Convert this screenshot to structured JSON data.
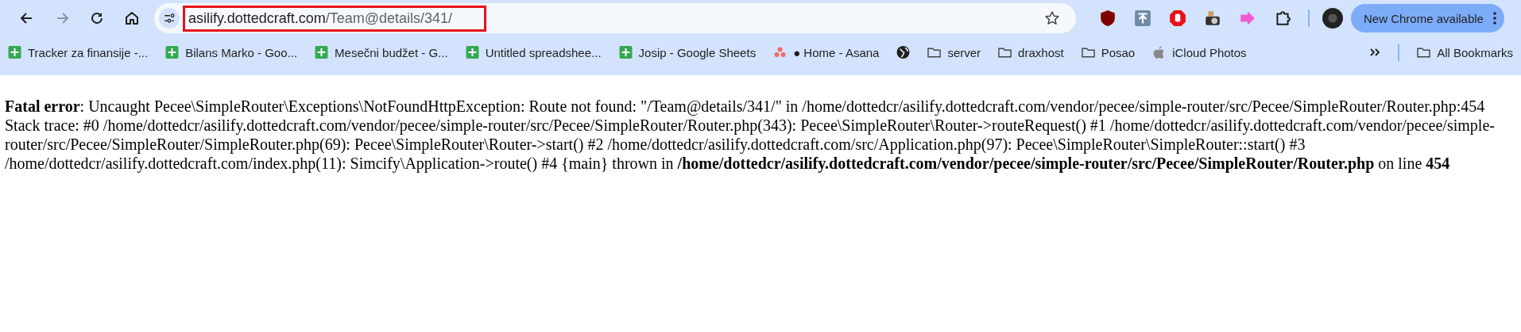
{
  "toolbar": {
    "url_host": "asilify.dottedcraft.com",
    "url_path": "/Team@details/341/",
    "url_highlighted": true,
    "update_button": "New Chrome available"
  },
  "bookmarks": [
    {
      "kind": "sheets",
      "label": "Tracker za finansije -..."
    },
    {
      "kind": "sheets",
      "label": "Bilans Marko - Goo..."
    },
    {
      "kind": "sheets",
      "label": "Mesečni budžet - G..."
    },
    {
      "kind": "sheets",
      "label": "Untitled spreadshee..."
    },
    {
      "kind": "sheets",
      "label": "Josip - Google Sheets"
    },
    {
      "kind": "asana",
      "label": "● Home - Asana"
    },
    {
      "kind": "globe"
    },
    {
      "kind": "folder",
      "label": "server"
    },
    {
      "kind": "folder",
      "label": "draxhost"
    },
    {
      "kind": "folder",
      "label": "Posao"
    },
    {
      "kind": "apple",
      "label": "iCloud Photos"
    }
  ],
  "all_bookmarks": "All Bookmarks",
  "error": {
    "message": "**Fatal error**: Uncaught Pecee\\SimpleRouter\\Exceptions\\NotFoundHttpException: Route not found: \"/Team@details/341/\" in /home/dottedcr/asilify.dottedcraft.com/vendor/pecee/simple-router/src/Pecee/SimpleRouter/Router.php:454 Stack trace: #0 /home/dottedcr/asilify.dottedcraft.com/vendor/pecee/simple-router/src/Pecee/SimpleRouter/Router.php(343): Pecee\\SimpleRouter\\Router->routeRequest() #1 /home/dottedcr/asilify.dottedcraft.com/vendor/pecee/simple-router/src/Pecee/SimpleRouter/SimpleRouter.php(69): Pecee\\SimpleRouter\\Router->start() #2 /home/dottedcr/asilify.dottedcraft.com/src/Application.php(97): Pecee\\SimpleRouter\\SimpleRouter::start() #3 /home/dottedcr/asilify.dottedcraft.com/index.php(11): Simcify\\Application->route() #4 {main} thrown in **/home/dottedcr/asilify.dottedcraft.com/vendor/pecee/simple-router/src/Pecee/SimpleRouter/Router.php** on line **454**"
  }
}
